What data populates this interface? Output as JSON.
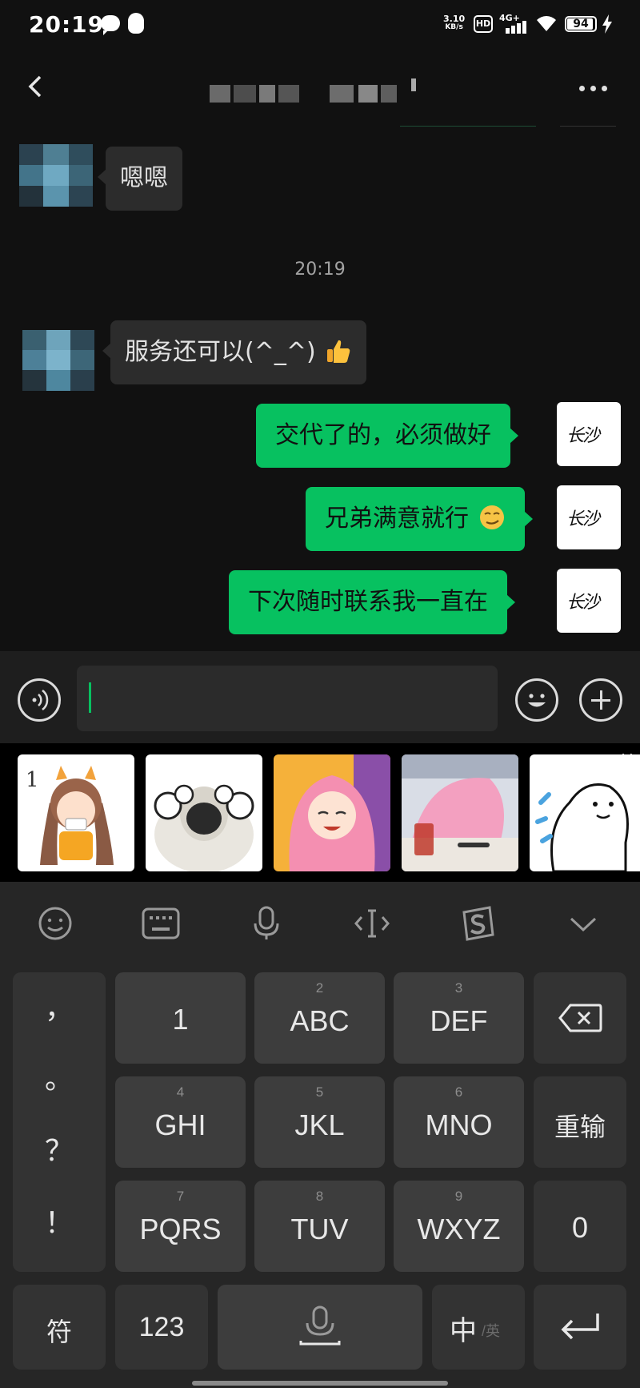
{
  "status_bar": {
    "time": "20:19",
    "net_speed_value": "3.10",
    "net_speed_unit": "KB/s",
    "hd_label": "HD",
    "network_type": "4G+",
    "battery_level": "94"
  },
  "chat": {
    "messages": [
      {
        "side": "in",
        "text": "嗯嗯"
      },
      {
        "side": "in",
        "text": "服务还可以(^_^)"
      },
      {
        "side": "out",
        "text": "交代了的，必须做好"
      },
      {
        "side": "out",
        "text": "兄弟满意就行"
      },
      {
        "side": "out",
        "text": "下次随时联系我一直在"
      }
    ],
    "timestamp": "20:19",
    "my_avatar_text": "长沙"
  },
  "sticker_count": 5,
  "keyboard": {
    "punct_keys": [
      "，",
      "。",
      "？",
      "！"
    ],
    "keys": [
      {
        "num": "",
        "label": "1"
      },
      {
        "num": "2",
        "label": "ABC"
      },
      {
        "num": "3",
        "label": "DEF"
      },
      {
        "num": "4",
        "label": "GHI"
      },
      {
        "num": "5",
        "label": "JKL"
      },
      {
        "num": "6",
        "label": "MNO"
      },
      {
        "num": "7",
        "label": "PQRS"
      },
      {
        "num": "8",
        "label": "TUV"
      },
      {
        "num": "9",
        "label": "WXYZ"
      }
    ],
    "reenter_label": "重输",
    "zero_label": "0",
    "symbol_label": "符",
    "num_label": "123",
    "lang_main": "中",
    "lang_alt": "/英"
  },
  "colors": {
    "accent": "#07c160",
    "background": "#111111",
    "incoming_bubble": "#2c2c2c",
    "keyboard_bg": "#262626",
    "key_bg": "#3d3d3d"
  }
}
